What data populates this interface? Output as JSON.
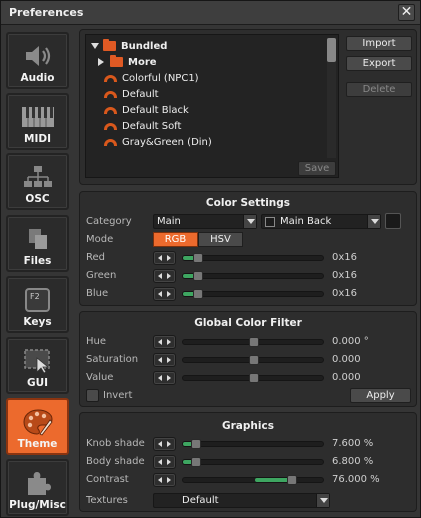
{
  "window": {
    "title": "Preferences",
    "close_glyph": "✕"
  },
  "sidebar": {
    "items": [
      {
        "label": "Audio",
        "icon": "speaker-icon",
        "active": false
      },
      {
        "label": "MIDI",
        "icon": "piano-keys-icon",
        "active": false
      },
      {
        "label": "OSC",
        "icon": "network-tree-icon",
        "active": false
      },
      {
        "label": "Files",
        "icon": "files-icon",
        "active": false
      },
      {
        "label": "Keys",
        "icon": "keyboard-key-icon",
        "active": false,
        "key_text": "F2"
      },
      {
        "label": "GUI",
        "icon": "cursor-window-icon",
        "active": false
      },
      {
        "label": "Theme",
        "icon": "palette-icon",
        "active": true
      },
      {
        "label": "Plug/Misc",
        "icon": "puzzle-icon",
        "active": false
      }
    ]
  },
  "themes": {
    "tree": [
      {
        "label": "Bundled",
        "kind": "folder",
        "expanded": true
      },
      {
        "label": "More",
        "kind": "folder",
        "expanded": false
      },
      {
        "label": "Colorful (NPC1)",
        "kind": "theme"
      },
      {
        "label": "Default",
        "kind": "theme"
      },
      {
        "label": "Default Black",
        "kind": "theme"
      },
      {
        "label": "Default Soft",
        "kind": "theme"
      },
      {
        "label": "Gray&Green (Din)",
        "kind": "theme"
      }
    ],
    "save_label": "Save",
    "import_label": "Import",
    "export_label": "Export",
    "delete_label": "Delete"
  },
  "color_settings": {
    "title": "Color Settings",
    "category_label": "Category",
    "category_value": "Main",
    "element_value": "Main Back",
    "swatch_color": "#1a1a1a",
    "mode_label": "Mode",
    "mode_rgb": "RGB",
    "mode_hsv": "HSV",
    "active_mode": "RGB",
    "red_label": "Red",
    "red_value": "0x16",
    "green_label": "Green",
    "green_value": "0x16",
    "blue_label": "Blue",
    "blue_value": "0x16"
  },
  "global_filter": {
    "title": "Global Color Filter",
    "hue_label": "Hue",
    "hue_value": "0.000 °",
    "saturation_label": "Saturation",
    "saturation_value": "0.000",
    "value_label": "Value",
    "value_value": "0.000",
    "invert_label": "Invert",
    "apply_label": "Apply"
  },
  "graphics": {
    "title": "Graphics",
    "knob_label": "Knob shade",
    "knob_value": "7.600 %",
    "body_label": "Body shade",
    "body_value": "6.800 %",
    "contrast_label": "Contrast",
    "contrast_value": "76.000 %",
    "textures_label": "Textures",
    "textures_value": "Default"
  },
  "colors": {
    "accent": "#ec6a2d",
    "slider_fill": "#3ea661"
  }
}
